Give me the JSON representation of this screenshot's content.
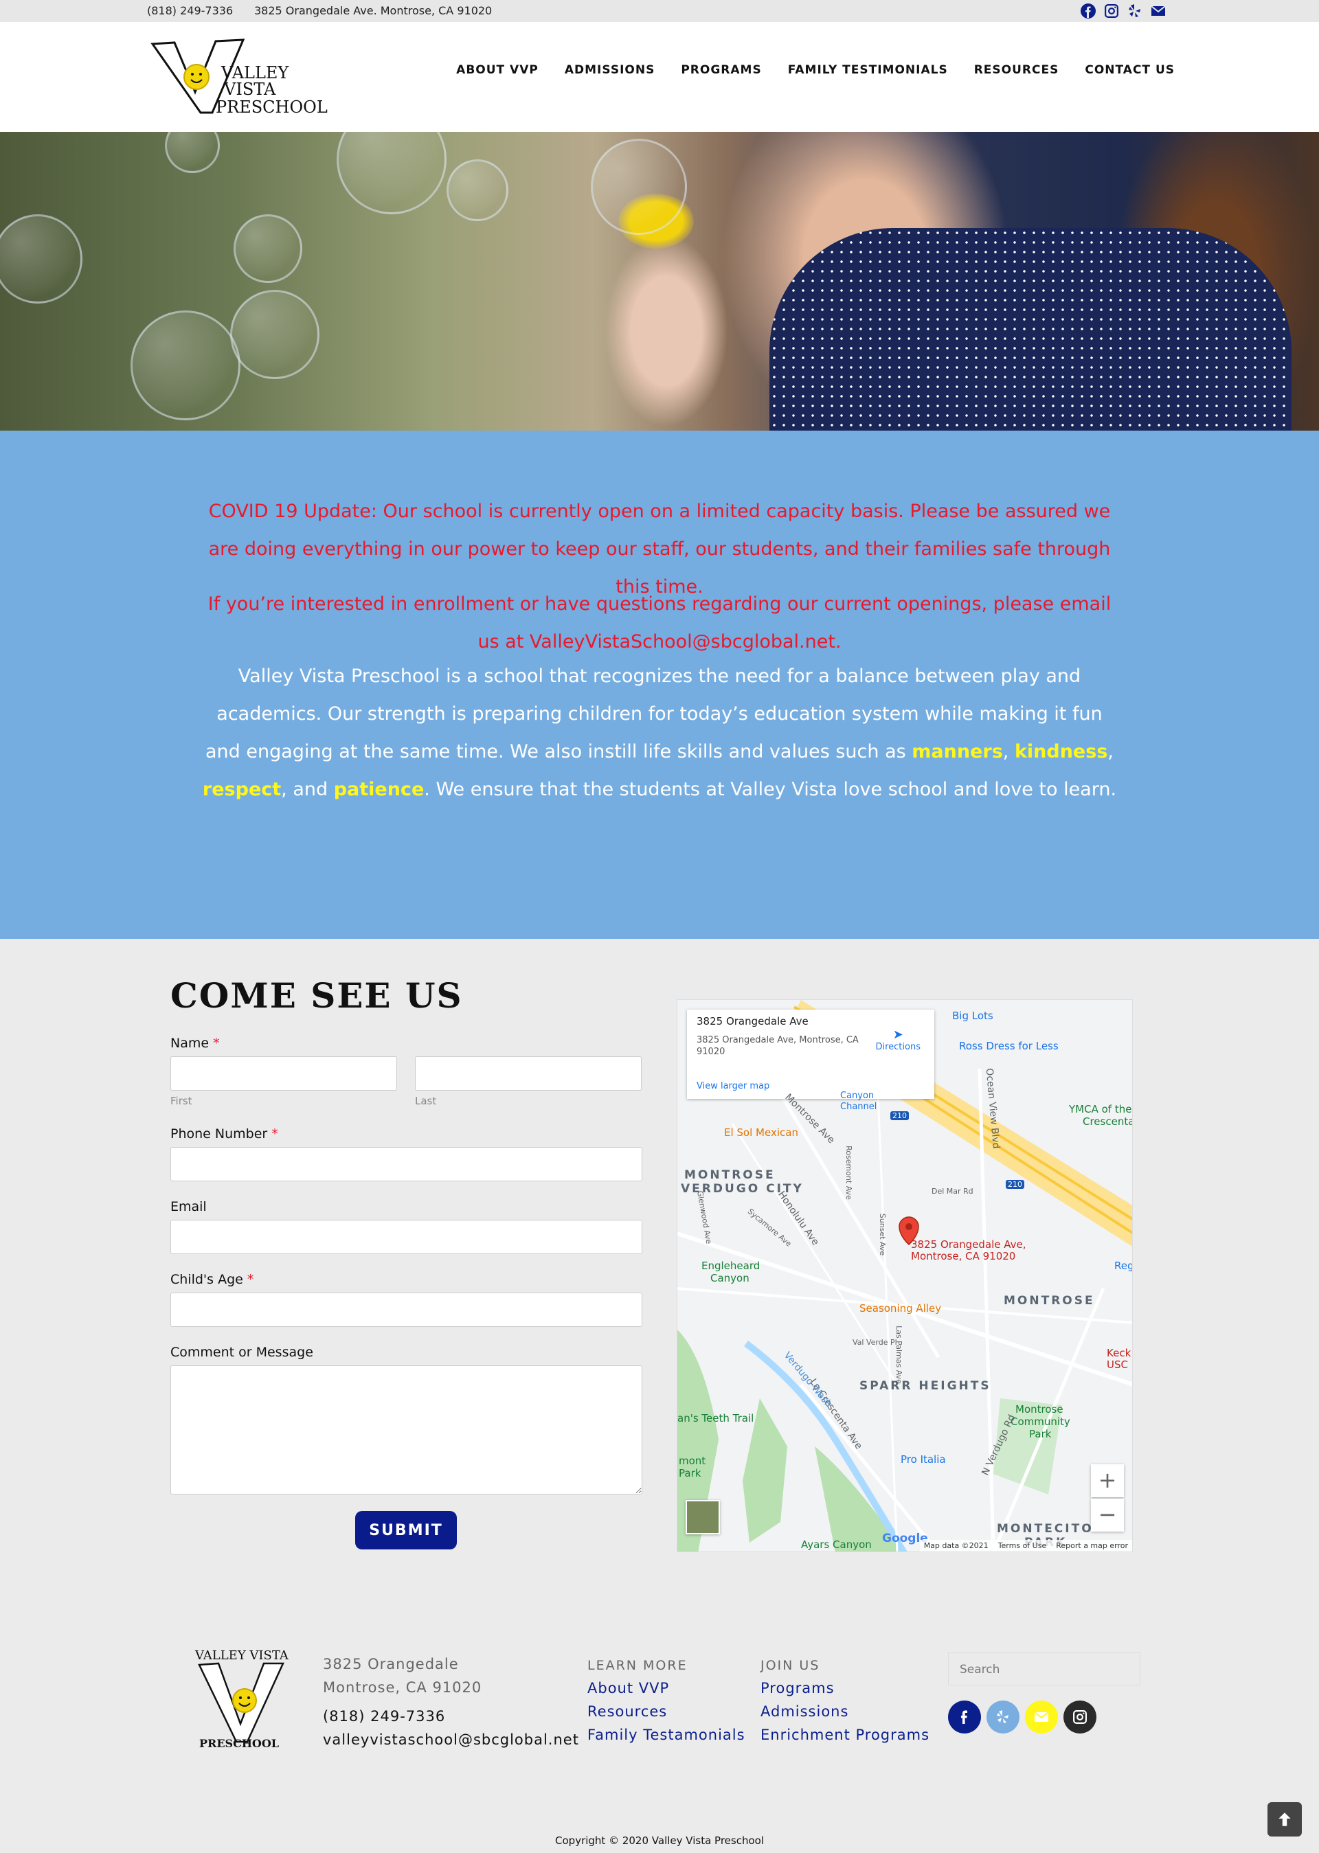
{
  "topbar": {
    "phone": "(818) 249-7336",
    "address": "3825 Orangedale Ave. Montrose, CA 91020",
    "social_icons": [
      "facebook-icon",
      "instagram-icon",
      "yelp-icon",
      "envelope-icon"
    ]
  },
  "logo": {
    "line1": "VALLEY",
    "line2": "VISTA",
    "line3": "PRESCHOOL"
  },
  "nav": {
    "items": [
      "ABOUT VVP",
      "ADMISSIONS",
      "PROGRAMS",
      "FAMILY TESTIMONIALS",
      "RESOURCES",
      "CONTACT US"
    ]
  },
  "announcement": {
    "covid": "COVID 19 Update: Our school is currently open on a limited capacity basis. Please be assured we are doing everything in our power to keep our staff, our students, and their families safe through this time.",
    "enroll": "If you’re interested in enrollment or have questions regarding our current openings, please email us at ValleyVistaSchool@sbcglobal.net.",
    "about_start": "Valley Vista Preschool is a school that recognizes the need for a balance between play and academics. Our strength is preparing children for today’s education system while making it fun and engaging at the same time. We also instill life skills and values such as ",
    "values": [
      "manners",
      "kindness",
      "respect",
      "patience"
    ],
    "sep1": ", ",
    "sep2": ", ",
    "sep3": ", and ",
    "about_end": ". We ensure that the students at Valley Vista love school and love to learn."
  },
  "form": {
    "title": "COME SEE US",
    "name_label": "Name",
    "first_sub": "First",
    "last_sub": "Last",
    "phone_label": "Phone Number",
    "email_label": "Email",
    "age_label": "Child's Age",
    "comment_label": "Comment or Message",
    "required_mark": "*",
    "submit_label": "SUBMIT"
  },
  "map": {
    "info_title": "3825 Orangedale Ave",
    "info_address": "3825 Orangedale Ave, Montrose, CA 91020",
    "directions": "Directions",
    "larger_map": "View larger map",
    "pin_label_1": "3825 Orangedale Ave,",
    "pin_label_2": "Montrose, CA 91020",
    "areas": [
      "MONTROSE",
      "VERDUGO CITY",
      "MONTROSE",
      "SPARR HEIGHTS",
      "MONTECITO",
      "PARK"
    ],
    "pois": [
      "Big Lots",
      "Ross Dress for Less",
      "YMCA of the",
      "Crescenta",
      "El Sol Mexican",
      "Engleheard",
      "Canyon",
      "Seasoning Alley",
      "Keck",
      "USC",
      "Montrose",
      "Community",
      "Park",
      "Pro Italia",
      "Ayars Canyon",
      "Canyon",
      "Channel",
      "an's Teeth Trail",
      "mont",
      "Park",
      "Reg"
    ],
    "streets": [
      "Montrose Ave",
      "Honolulu Ave",
      "Ocean View Blvd",
      "Del Mar Rd",
      "La Crescenta Ave",
      "N Verdugo Rd",
      "Verdugo Wash",
      "Sycamore Ave",
      "Rosemont Ave",
      "Glenwood Ave",
      "Val Verde Pl",
      "Las Palmas Ave",
      "Sunset Ave"
    ],
    "highway": "210",
    "zoom_in": "+",
    "zoom_out": "−",
    "google": "Google",
    "footer": [
      "Map data ©2021",
      "Terms of Use",
      "Report a map error"
    ]
  },
  "footer": {
    "logo_top": "VALLEY VISTA",
    "logo_bottom": "PRESCHOOL",
    "address_1": "3825 Orangedale",
    "address_2": "Montrose, CA 91020",
    "phone": "(818) 249-7336",
    "email": "valleyvistaschool@sbcglobal.net",
    "learn_more": {
      "heading": "LEARN MORE",
      "links": [
        "About VVP",
        "Resources",
        "Family Testamonials"
      ]
    },
    "join_us": {
      "heading": "JOIN US",
      "links": [
        "Programs",
        "Admissions",
        "Enrichment Programs"
      ]
    },
    "search_placeholder": "Search",
    "social": [
      {
        "icon": "facebook-icon",
        "color": "#0b1f8c"
      },
      {
        "icon": "yelp-icon",
        "color": "#7aaee0"
      },
      {
        "icon": "envelope-icon",
        "color": "#fff61a"
      },
      {
        "icon": "instagram-icon",
        "color": "#2a2a2a"
      }
    ],
    "copyright": "Copyright © 2020 Valley Vista Preschool"
  },
  "colors": {
    "accent_blue": "#75ade0",
    "navy": "#0b1f8c",
    "alert_red": "#e8192c",
    "highlight_yellow": "#fff61a"
  }
}
